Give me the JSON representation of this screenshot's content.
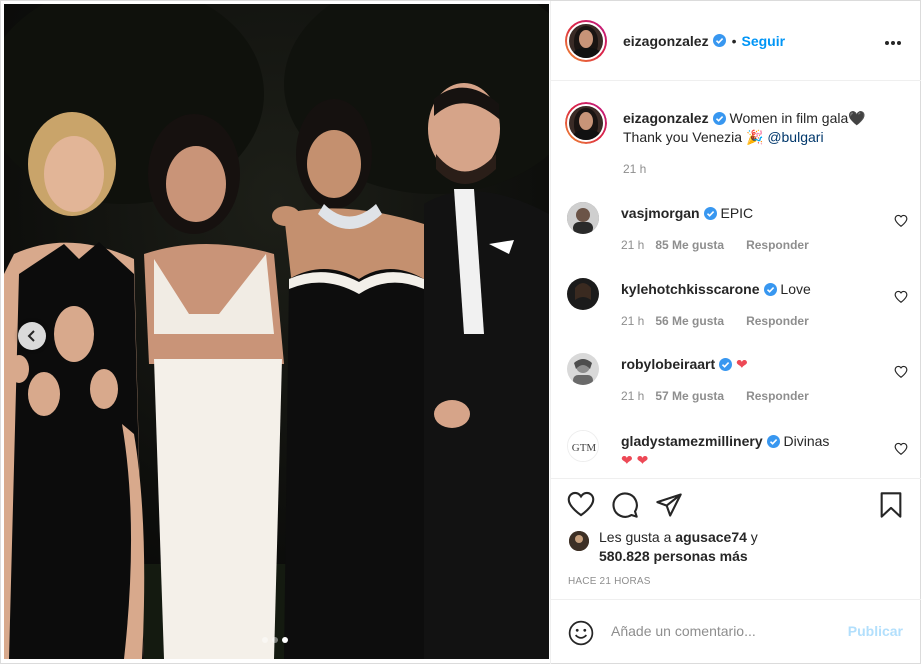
{
  "post": {
    "author": "eizagonzalez",
    "follow_label": "Seguir",
    "more_icon": "more-options-icon",
    "carousel": {
      "total": 3,
      "active": 3
    }
  },
  "caption": {
    "username": "eizagonzalez",
    "text": "Women in film gala",
    "emoji_heart": "🖤",
    "line2": "Thank you Venezia",
    "emoji_party": "🎉",
    "mention": "@bulgari",
    "time": "21 h"
  },
  "comments": [
    {
      "username": "vasjmorgan",
      "text": "EPIC",
      "time": "21 h",
      "likes": "85 Me gusta",
      "reply": "Responder"
    },
    {
      "username": "kylehotchkisscarone",
      "text": "Love",
      "time": "21 h",
      "likes": "56 Me gusta",
      "reply": "Responder"
    },
    {
      "username": "robylobeiraart",
      "text": "❤",
      "time": "21 h",
      "likes": "57 Me gusta",
      "reply": "Responder"
    },
    {
      "username": "gladystamezmillinery",
      "text": "Divinas",
      "line2": "❤ ❤"
    }
  ],
  "likes": {
    "prefix": "Les gusta a",
    "user": "agusace74",
    "suffix": "y",
    "others": "580.828 personas más"
  },
  "timestamp": "HACE 21 HORAS",
  "composer": {
    "placeholder": "Añade un comentario...",
    "publish": "Publicar"
  },
  "colors": {
    "accent": "#0095f6",
    "verified": "#3897f0",
    "heart": "#ed4956",
    "muted": "#8e8e8e"
  }
}
